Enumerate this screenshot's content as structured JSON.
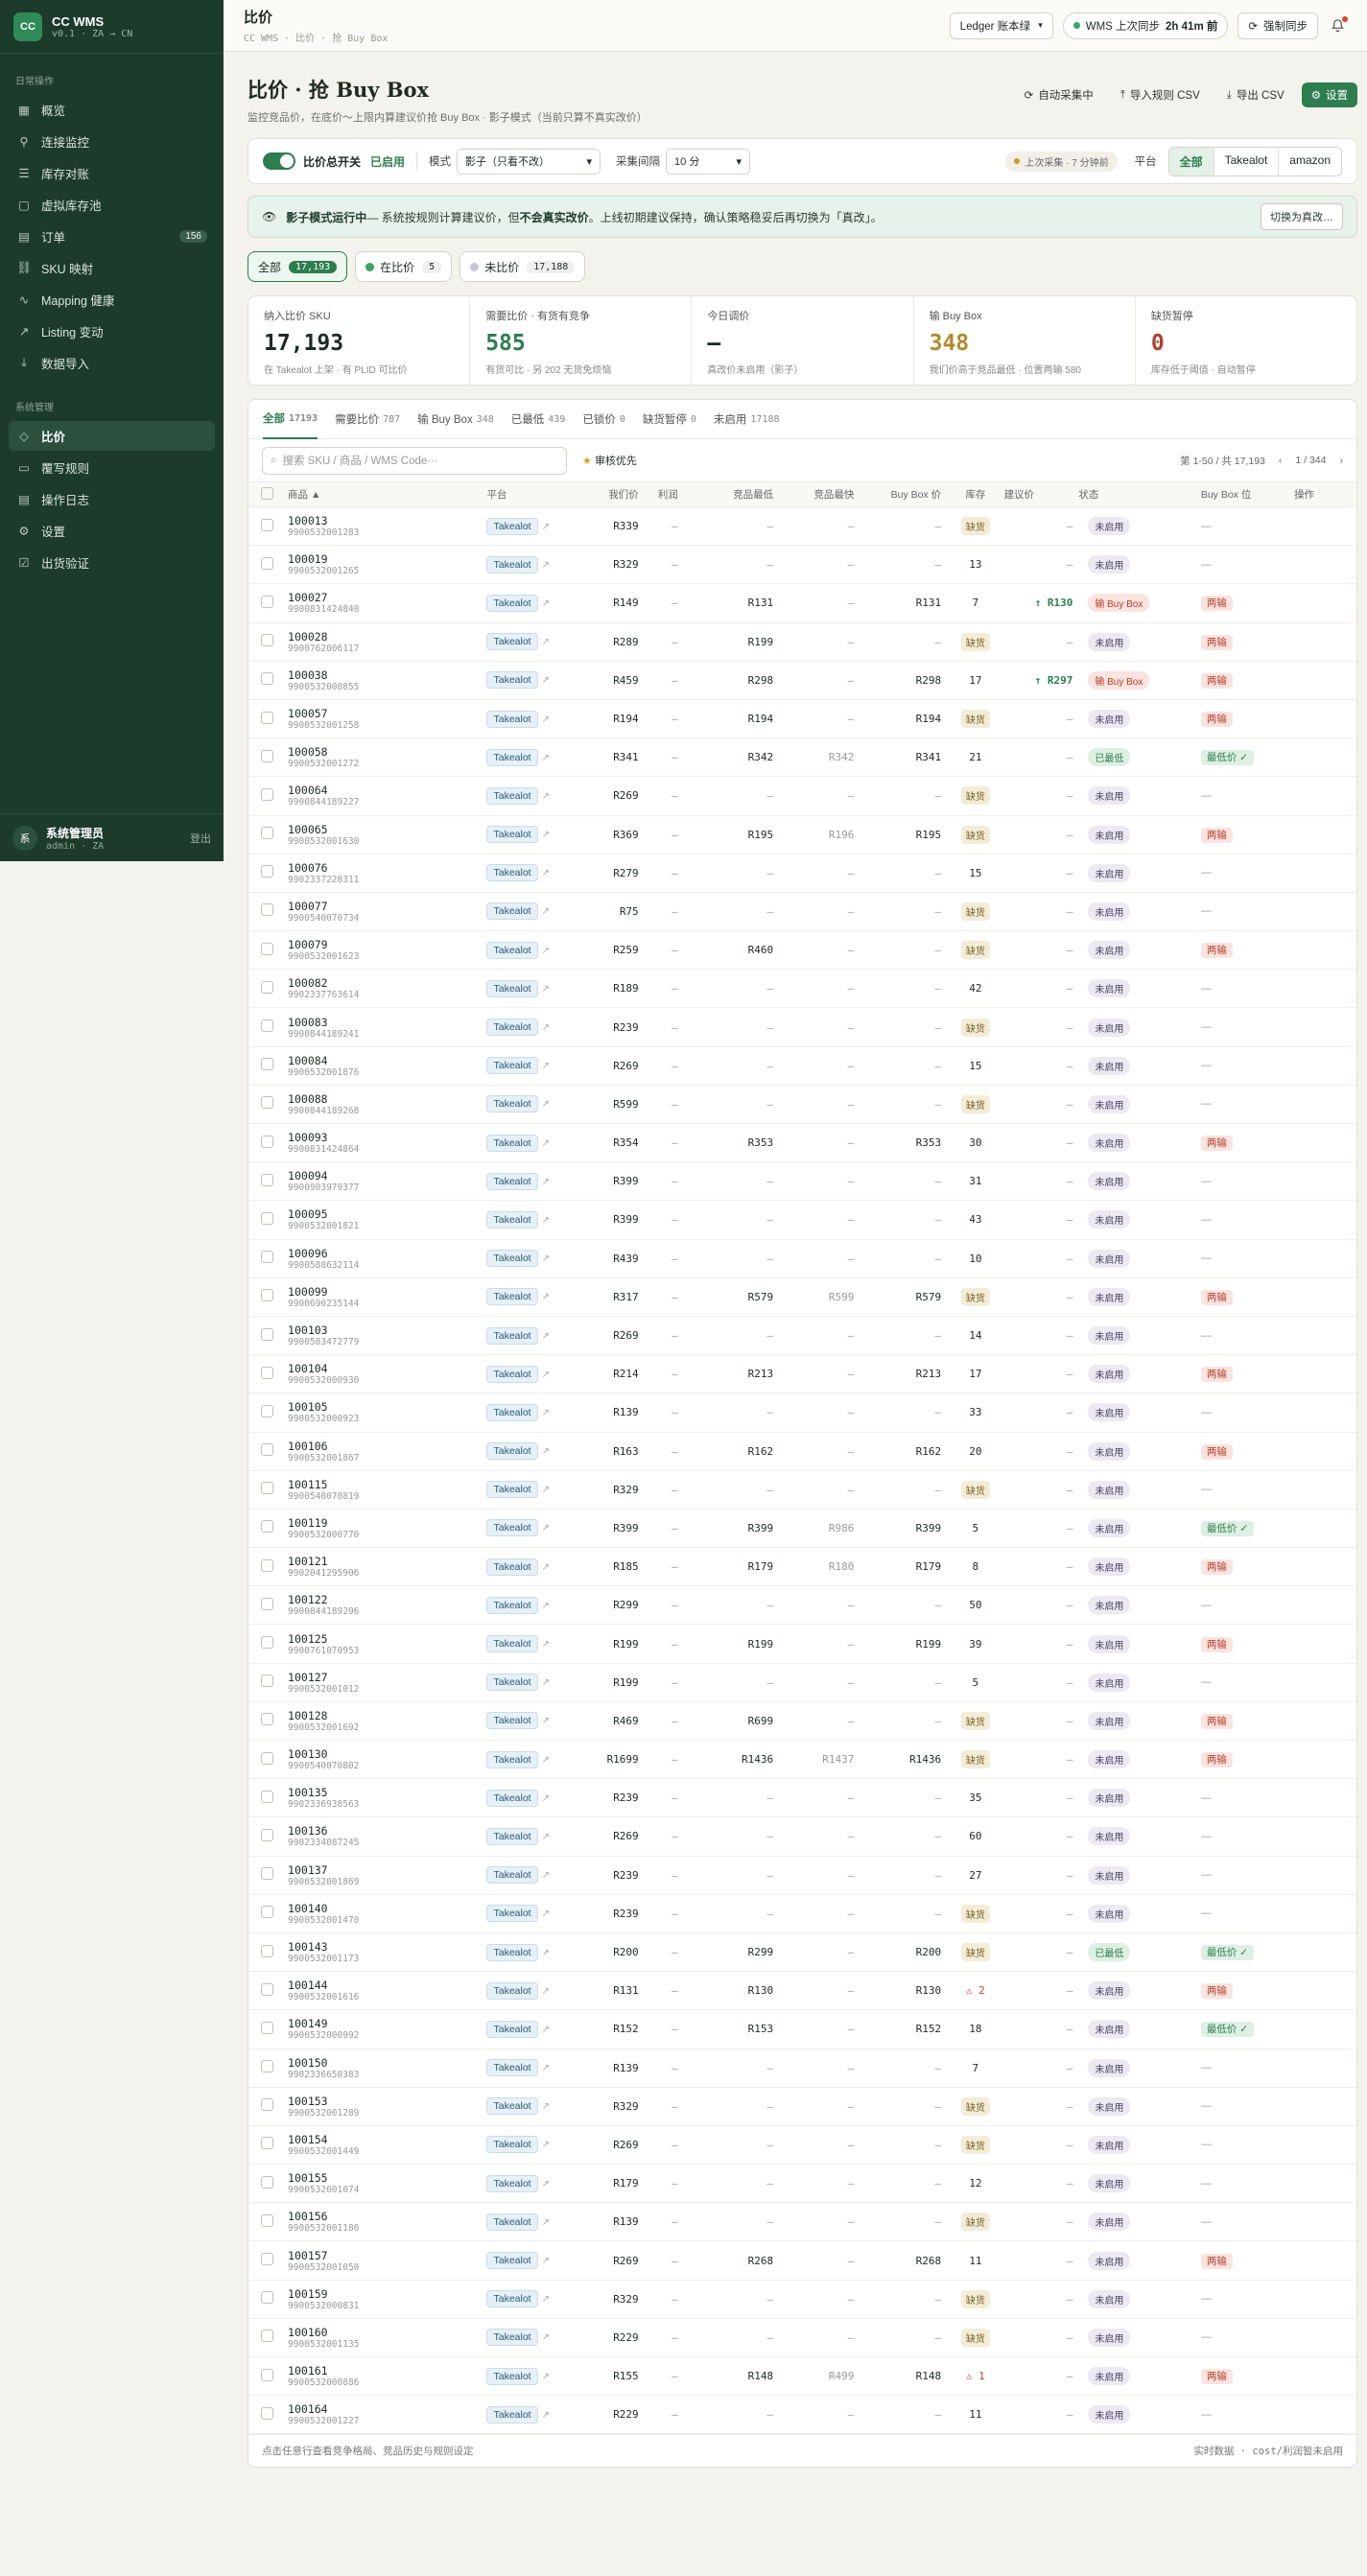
{
  "brand": {
    "name": "CC WMS",
    "version": "v0.1 · ZA → CN"
  },
  "sidebar": {
    "section1": "日常操作",
    "items1": [
      {
        "label": "概览",
        "icon": "grid-icon"
      },
      {
        "label": "连接监控",
        "icon": "plug-icon"
      },
      {
        "label": "库存对账",
        "icon": "sliders-icon"
      },
      {
        "label": "虚拟库存池",
        "icon": "box-icon"
      },
      {
        "label": "订单",
        "icon": "clipboard-icon",
        "badge": "156"
      },
      {
        "label": "SKU 映射",
        "icon": "link-icon"
      },
      {
        "label": "Mapping 健康",
        "icon": "activity-icon"
      },
      {
        "label": "Listing 变动",
        "icon": "trend-icon"
      },
      {
        "label": "数据导入",
        "icon": "download-icon"
      }
    ],
    "section2": "系统管理",
    "items2": [
      {
        "label": "比价",
        "icon": "tag-icon",
        "active": true
      },
      {
        "label": "覆写规则",
        "icon": "file-icon"
      },
      {
        "label": "操作日志",
        "icon": "log-icon"
      },
      {
        "label": "设置",
        "icon": "gear-icon"
      },
      {
        "label": "出货验证",
        "icon": "check-file-icon"
      }
    ]
  },
  "user": {
    "avatar": "系",
    "name": "系统管理员",
    "sub": "admin · ZA",
    "logout": "登出"
  },
  "topbar": {
    "title": "比价",
    "breadcrumb": "CC WMS · 比价 · 抢 Buy Box",
    "ledger": "Ledger 账本绿",
    "sync_label": "WMS 上次同步",
    "sync_time": "2h 41m 前",
    "force_sync": "强制同步"
  },
  "header": {
    "title": "比价 · 抢 Buy Box",
    "subtitle": "监控竞品价，在底价～上限内算建议价抢 Buy Box · 影子模式（当前只算不真实改价）",
    "actions": {
      "auto_collect": "自动采集中",
      "import": "导入规则 CSV",
      "export": "导出 CSV",
      "settings": "设置"
    }
  },
  "controls": {
    "switch_label": "比价总开关",
    "switch_state": "已启用",
    "mode_label": "模式",
    "mode_value": "影子（只看不改）",
    "interval_label": "采集间隔",
    "interval_value": "10 分",
    "last_collect": "上次采集 · 7 分钟前",
    "platform_label": "平台",
    "platforms": [
      "全部",
      "Takealot",
      "amazon"
    ]
  },
  "banner": {
    "title": "影子模式运行中",
    "text1": " — 系统按规则计算建议价，但",
    "bold": "不会真实改价",
    "text2": "。上线初期建议保持，确认策略稳妥后再切换为「真改」。",
    "button": "切换为真改…"
  },
  "chips": [
    {
      "label": "全部",
      "count": "17,193",
      "active": true
    },
    {
      "label": "在比价",
      "count": "5",
      "color": "#3aa564"
    },
    {
      "label": "未比价",
      "count": "17,188",
      "color": "#c9c4dc"
    }
  ],
  "stats": [
    {
      "label": "纳入比价 SKU",
      "value": "17,193",
      "note": "在 Takealot 上架 · 有 PLID 可比价",
      "color": "#1f2a24"
    },
    {
      "label": "需要比价 · 有货有竞争",
      "value": "585",
      "note": "有货可比 · 另 202 无货免烦恼",
      "color": "#2e7d4f"
    },
    {
      "label": "今日调价",
      "value": "—",
      "note": "真改价未启用（影子）",
      "color": "#1f2a24"
    },
    {
      "label": "输 Buy Box",
      "value": "348",
      "note": "我们价高于竞品最低 · 位置两输 580",
      "color": "#b08a2a"
    },
    {
      "label": "缺货暂停",
      "value": "0",
      "note": "库存低于阈值 · 自动暂停",
      "color": "#b2412d"
    }
  ],
  "tabs": [
    {
      "label": "全部",
      "count": "17193",
      "active": true
    },
    {
      "label": "需要比价",
      "count": "787"
    },
    {
      "label": "输 Buy Box",
      "count": "348"
    },
    {
      "label": "已最低",
      "count": "439"
    },
    {
      "label": "已锁价",
      "count": "0"
    },
    {
      "label": "缺货暂停",
      "count": "0"
    },
    {
      "label": "未启用",
      "count": "17188"
    }
  ],
  "search": {
    "placeholder": "搜索 SKU / 商品 / WMS Code···",
    "priority": "审核优先",
    "range": "第 1-50 / 共 17,193",
    "page": "1 / 344"
  },
  "columns": [
    "商品 ▲",
    "平台",
    "我们价",
    "利润",
    "竞品最低",
    "竞品最快",
    "Buy Box 价",
    "库存",
    "建议价",
    "状态",
    "Buy Box 位",
    "操作"
  ],
  "rows": [
    {
      "sku": "100013",
      "bc": "9900532001283",
      "price": "R339",
      "low": "—",
      "fast": "—",
      "bb": "—",
      "stock": "缺货",
      "sug": "",
      "status": "未启用",
      "pos": "—"
    },
    {
      "sku": "100019",
      "bc": "9900532001265",
      "price": "R329",
      "low": "—",
      "fast": "—",
      "bb": "—",
      "stock": "13",
      "sug": "",
      "status": "未启用",
      "pos": "—"
    },
    {
      "sku": "100027",
      "bc": "9900831424840",
      "price": "R149",
      "low": "R131",
      "fast": "—",
      "bb": "R131",
      "stock": "7",
      "sug": "↑ R130",
      "status": "输 Buy Box",
      "pos": "两输"
    },
    {
      "sku": "100028",
      "bc": "9900762006117",
      "price": "R289",
      "low": "R199",
      "fast": "—",
      "bb": "—",
      "stock": "缺货",
      "sug": "",
      "status": "未启用",
      "pos": "两输"
    },
    {
      "sku": "100038",
      "bc": "9900532000855",
      "price": "R459",
      "low": "R298",
      "fast": "—",
      "bb": "R298",
      "stock": "17",
      "sug": "↑ R297",
      "status": "输 Buy Box",
      "pos": "两输"
    },
    {
      "sku": "100057",
      "bc": "9900532001258",
      "price": "R194",
      "low": "R194",
      "fast": "—",
      "bb": "R194",
      "stock": "缺货",
      "sug": "",
      "status": "未启用",
      "pos": "两输"
    },
    {
      "sku": "100058",
      "bc": "9900532001272",
      "price": "R341",
      "low": "R342",
      "fast": "R342",
      "bb": "R341",
      "stock": "21",
      "sug": "",
      "status": "已最低",
      "pos": "最低价 ✓"
    },
    {
      "sku": "100064",
      "bc": "9900844189227",
      "price": "R269",
      "low": "—",
      "fast": "—",
      "bb": "—",
      "stock": "缺货",
      "sug": "",
      "status": "未启用",
      "pos": "—"
    },
    {
      "sku": "100065",
      "bc": "9900532001630",
      "price": "R369",
      "low": "R195",
      "fast": "R196",
      "bb": "R195",
      "stock": "缺货",
      "sug": "",
      "status": "未启用",
      "pos": "两输"
    },
    {
      "sku": "100076",
      "bc": "9902337228311",
      "price": "R279",
      "low": "—",
      "fast": "—",
      "bb": "—",
      "stock": "15",
      "sug": "",
      "status": "未启用",
      "pos": "—"
    },
    {
      "sku": "100077",
      "bc": "9900540070734",
      "price": "R75",
      "low": "—",
      "fast": "—",
      "bb": "—",
      "stock": "缺货",
      "sug": "",
      "status": "未启用",
      "pos": "—"
    },
    {
      "sku": "100079",
      "bc": "9900532001623",
      "price": "R259",
      "low": "R460",
      "fast": "—",
      "bb": "—",
      "stock": "缺货",
      "sug": "",
      "status": "未启用",
      "pos": "两输"
    },
    {
      "sku": "100082",
      "bc": "9902337763614",
      "price": "R189",
      "low": "—",
      "fast": "—",
      "bb": "—",
      "stock": "42",
      "sug": "",
      "status": "未启用",
      "pos": "—"
    },
    {
      "sku": "100083",
      "bc": "9900844189241",
      "price": "R239",
      "low": "—",
      "fast": "—",
      "bb": "—",
      "stock": "缺货",
      "sug": "",
      "status": "未启用",
      "pos": "—"
    },
    {
      "sku": "100084",
      "bc": "9900532001876",
      "price": "R269",
      "low": "—",
      "fast": "—",
      "bb": "—",
      "stock": "15",
      "sug": "",
      "status": "未启用",
      "pos": "—"
    },
    {
      "sku": "100088",
      "bc": "9900844189268",
      "price": "R599",
      "low": "—",
      "fast": "—",
      "bb": "—",
      "stock": "缺货",
      "sug": "",
      "status": "未启用",
      "pos": "—"
    },
    {
      "sku": "100093",
      "bc": "9900831424864",
      "price": "R354",
      "low": "R353",
      "fast": "—",
      "bb": "R353",
      "stock": "30",
      "sug": "",
      "status": "未启用",
      "pos": "两输"
    },
    {
      "sku": "100094",
      "bc": "9900903979377",
      "price": "R399",
      "low": "—",
      "fast": "—",
      "bb": "—",
      "stock": "31",
      "sug": "",
      "status": "未启用",
      "pos": "—"
    },
    {
      "sku": "100095",
      "bc": "9900532001821",
      "price": "R399",
      "low": "—",
      "fast": "—",
      "bb": "—",
      "stock": "43",
      "sug": "",
      "status": "未启用",
      "pos": "—"
    },
    {
      "sku": "100096",
      "bc": "9900588632114",
      "price": "R439",
      "low": "—",
      "fast": "—",
      "bb": "—",
      "stock": "10",
      "sug": "",
      "status": "未启用",
      "pos": "—"
    },
    {
      "sku": "100099",
      "bc": "9900690235144",
      "price": "R317",
      "low": "R579",
      "fast": "R599",
      "bb": "R579",
      "stock": "缺货",
      "sug": "",
      "status": "未启用",
      "pos": "两输"
    },
    {
      "sku": "100103",
      "bc": "9900583472779",
      "price": "R269",
      "low": "—",
      "fast": "—",
      "bb": "—",
      "stock": "14",
      "sug": "",
      "status": "未启用",
      "pos": "—"
    },
    {
      "sku": "100104",
      "bc": "9900532000930",
      "price": "R214",
      "low": "R213",
      "fast": "—",
      "bb": "R213",
      "stock": "17",
      "sug": "",
      "status": "未启用",
      "pos": "两输"
    },
    {
      "sku": "100105",
      "bc": "9900532000923",
      "price": "R139",
      "low": "—",
      "fast": "—",
      "bb": "—",
      "stock": "33",
      "sug": "",
      "status": "未启用",
      "pos": "—"
    },
    {
      "sku": "100106",
      "bc": "9900532001867",
      "price": "R163",
      "low": "R162",
      "fast": "—",
      "bb": "R162",
      "stock": "20",
      "sug": "",
      "status": "未启用",
      "pos": "两输"
    },
    {
      "sku": "100115",
      "bc": "9900540070819",
      "price": "R329",
      "low": "—",
      "fast": "—",
      "bb": "—",
      "stock": "缺货",
      "sug": "",
      "status": "未启用",
      "pos": "—"
    },
    {
      "sku": "100119",
      "bc": "9900532000770",
      "price": "R399",
      "low": "R399",
      "fast": "R986",
      "bb": "R399",
      "stock": "5",
      "sug": "",
      "status": "未启用",
      "pos": "最低价 ✓"
    },
    {
      "sku": "100121",
      "bc": "9902041295906",
      "price": "R185",
      "low": "R179",
      "fast": "R180",
      "bb": "R179",
      "stock": "8",
      "sug": "",
      "status": "未启用",
      "pos": "两输"
    },
    {
      "sku": "100122",
      "bc": "9900844189296",
      "price": "R299",
      "low": "—",
      "fast": "—",
      "bb": "—",
      "stock": "50",
      "sug": "",
      "status": "未启用",
      "pos": "—"
    },
    {
      "sku": "100125",
      "bc": "9900761070953",
      "price": "R199",
      "low": "R199",
      "fast": "—",
      "bb": "R199",
      "stock": "39",
      "sug": "",
      "status": "未启用",
      "pos": "两输"
    },
    {
      "sku": "100127",
      "bc": "9900532001012",
      "price": "R199",
      "low": "—",
      "fast": "—",
      "bb": "—",
      "stock": "5",
      "sug": "",
      "status": "未启用",
      "pos": "—"
    },
    {
      "sku": "100128",
      "bc": "9900532001692",
      "price": "R469",
      "low": "R699",
      "fast": "—",
      "bb": "—",
      "stock": "缺货",
      "sug": "",
      "status": "未启用",
      "pos": "两输"
    },
    {
      "sku": "100130",
      "bc": "9900540070802",
      "price": "R1699",
      "low": "R1436",
      "fast": "R1437",
      "bb": "R1436",
      "stock": "缺货",
      "sug": "",
      "status": "未启用",
      "pos": "两输"
    },
    {
      "sku": "100135",
      "bc": "9902336938563",
      "price": "R239",
      "low": "—",
      "fast": "—",
      "bb": "—",
      "stock": "35",
      "sug": "",
      "status": "未启用",
      "pos": "—"
    },
    {
      "sku": "100136",
      "bc": "9902334087245",
      "price": "R269",
      "low": "—",
      "fast": "—",
      "bb": "—",
      "stock": "60",
      "sug": "",
      "status": "未启用",
      "pos": "—"
    },
    {
      "sku": "100137",
      "bc": "9900532001869",
      "price": "R239",
      "low": "—",
      "fast": "—",
      "bb": "—",
      "stock": "27",
      "sug": "",
      "status": "未启用",
      "pos": "—"
    },
    {
      "sku": "100140",
      "bc": "9900532001470",
      "price": "R239",
      "low": "—",
      "fast": "—",
      "bb": "—",
      "stock": "缺货",
      "sug": "",
      "status": "未启用",
      "pos": "—"
    },
    {
      "sku": "100143",
      "bc": "9900532001173",
      "price": "R200",
      "low": "R299",
      "fast": "—",
      "bb": "R200",
      "stock": "缺货",
      "sug": "",
      "status": "已最低",
      "pos": "最低价 ✓"
    },
    {
      "sku": "100144",
      "bc": "9900532001616",
      "price": "R131",
      "low": "R130",
      "fast": "—",
      "bb": "R130",
      "stock": "⚠ 2",
      "sug": "",
      "status": "未启用",
      "pos": "两输"
    },
    {
      "sku": "100149",
      "bc": "9900532000992",
      "price": "R152",
      "low": "R153",
      "fast": "—",
      "bb": "R152",
      "stock": "18",
      "sug": "",
      "status": "未启用",
      "pos": "最低价 ✓"
    },
    {
      "sku": "100150",
      "bc": "9902336650383",
      "price": "R139",
      "low": "—",
      "fast": "—",
      "bb": "—",
      "stock": "7",
      "sug": "",
      "status": "未启用",
      "pos": "—"
    },
    {
      "sku": "100153",
      "bc": "9900532001289",
      "price": "R329",
      "low": "—",
      "fast": "—",
      "bb": "—",
      "stock": "缺货",
      "sug": "",
      "status": "未启用",
      "pos": "—"
    },
    {
      "sku": "100154",
      "bc": "9900532001449",
      "price": "R269",
      "low": "—",
      "fast": "—",
      "bb": "—",
      "stock": "缺货",
      "sug": "",
      "status": "未启用",
      "pos": "—"
    },
    {
      "sku": "100155",
      "bc": "9900532001074",
      "price": "R179",
      "low": "—",
      "fast": "—",
      "bb": "—",
      "stock": "12",
      "sug": "",
      "status": "未启用",
      "pos": "—"
    },
    {
      "sku": "100156",
      "bc": "9900532001180",
      "price": "R139",
      "low": "—",
      "fast": "—",
      "bb": "—",
      "stock": "缺货",
      "sug": "",
      "status": "未启用",
      "pos": "—"
    },
    {
      "sku": "100157",
      "bc": "9900532001050",
      "price": "R269",
      "low": "R268",
      "fast": "—",
      "bb": "R268",
      "stock": "11",
      "sug": "",
      "status": "未启用",
      "pos": "两输"
    },
    {
      "sku": "100159",
      "bc": "9900532000831",
      "price": "R329",
      "low": "—",
      "fast": "—",
      "bb": "—",
      "stock": "缺货",
      "sug": "",
      "status": "未启用",
      "pos": "—"
    },
    {
      "sku": "100160",
      "bc": "9900532001135",
      "price": "R229",
      "low": "—",
      "fast": "—",
      "bb": "—",
      "stock": "缺货",
      "sug": "",
      "status": "未启用",
      "pos": "—"
    },
    {
      "sku": "100161",
      "bc": "9900532000886",
      "price": "R155",
      "low": "R148",
      "fast": "R499",
      "bb": "R148",
      "stock": "⚠ 1",
      "sug": "",
      "status": "未启用",
      "pos": "两输"
    },
    {
      "sku": "100164",
      "bc": "9900532001227",
      "price": "R229",
      "low": "—",
      "fast": "—",
      "bb": "—",
      "stock": "11",
      "sug": "",
      "status": "未启用",
      "pos": "—"
    }
  ],
  "table_platform": "Takealot",
  "profit_placeholder": "—",
  "footer": {
    "left": "点击任意行查看竞争格局、竞品历史与规则设定",
    "right": "实时数据 · cost/利润暂未启用"
  }
}
